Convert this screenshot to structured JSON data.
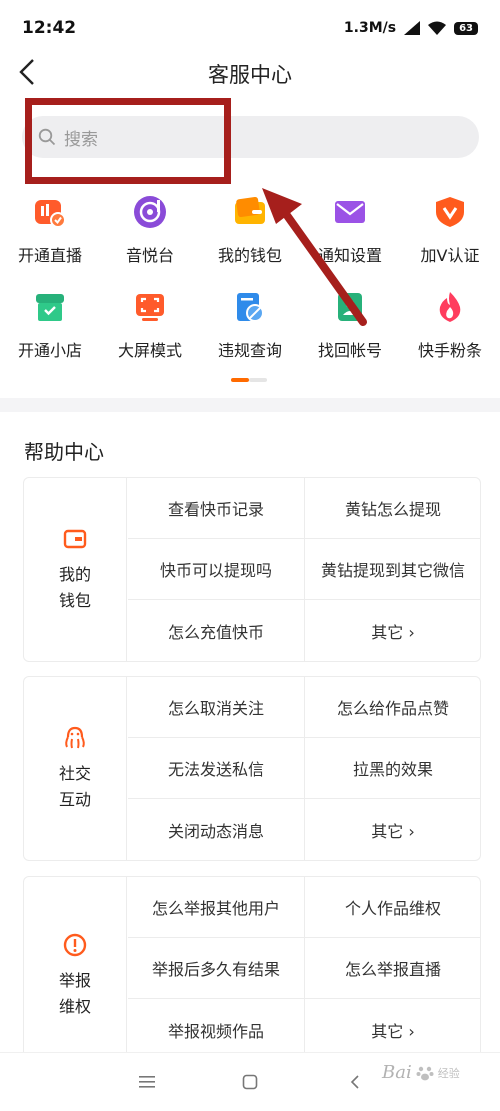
{
  "status": {
    "time": "12:42",
    "network_speed": "1.3M/s",
    "battery": "63"
  },
  "nav": {
    "title": "客服中心"
  },
  "search": {
    "placeholder": "搜索"
  },
  "shortcuts": [
    [
      {
        "label": "开通直播",
        "icon": "live-broadcast-icon",
        "color": "#ff5b2b"
      },
      {
        "label": "音悦台",
        "icon": "music-disc-icon",
        "color": "#8a4bd8"
      },
      {
        "label": "我的钱包",
        "icon": "wallet-icon",
        "color": "#ff9a00"
      },
      {
        "label": "通知设置",
        "icon": "notification-envelope-icon",
        "color": "#9b52e6"
      },
      {
        "label": "加V认证",
        "icon": "v-shield-icon",
        "color": "#ff5b1d"
      }
    ],
    [
      {
        "label": "开通小店",
        "icon": "shop-icon",
        "color": "#27b17a"
      },
      {
        "label": "大屏模式",
        "icon": "fullscreen-icon",
        "color": "#ff5b2b"
      },
      {
        "label": "违规查询",
        "icon": "violation-search-icon",
        "color": "#2f8bea"
      },
      {
        "label": "找回帐号",
        "icon": "account-recover-icon",
        "color": "#27b17a"
      },
      {
        "label": "快手粉条",
        "icon": "flame-icon",
        "color": "#ff3d5e"
      }
    ]
  ],
  "help": {
    "title": "帮助中心",
    "categories": [
      {
        "name": "我的\n钱包",
        "icon": "wallet-icon",
        "color": "#ff5b1d",
        "items": [
          [
            "查看快币记录",
            "黄钻怎么提现"
          ],
          [
            "快币可以提现吗",
            "黄钻提现到其它微信"
          ],
          [
            "怎么充值快币",
            "其它 ›"
          ]
        ]
      },
      {
        "name": "社交\n互动",
        "icon": "octopus-icon",
        "color": "#ff5b1d",
        "items": [
          [
            "怎么取消关注",
            "怎么给作品点赞"
          ],
          [
            "无法发送私信",
            "拉黑的效果"
          ],
          [
            "关闭动态消息",
            "其它 ›"
          ]
        ]
      },
      {
        "name": "举报\n维权",
        "icon": "exclamation-icon",
        "color": "#ff5b1d",
        "items": [
          [
            "怎么举报其他用户",
            "个人作品维权"
          ],
          [
            "举报后多久有结果",
            "怎么举报直播"
          ],
          [
            "举报视频作品",
            "其它 ›"
          ]
        ]
      }
    ]
  },
  "watermark": {
    "text": "Bai",
    "sub": "经验"
  },
  "colors": {
    "accent": "#ff6a00",
    "annotation_red": "#a61f1c"
  }
}
